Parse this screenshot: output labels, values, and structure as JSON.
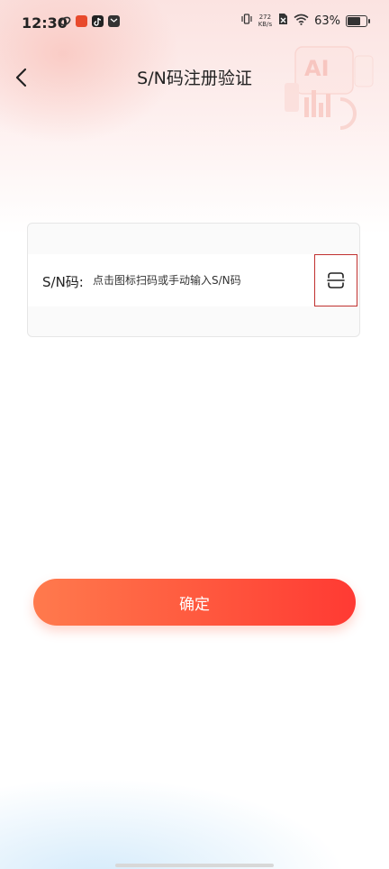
{
  "status_bar": {
    "time": "12:30",
    "net_speed_value": "272",
    "net_speed_unit": "KB/s",
    "battery_percent": "63%",
    "battery_level": 0.63
  },
  "header": {
    "title": "S/N码注册验证"
  },
  "decoration": {
    "text": "AI"
  },
  "form": {
    "sn_label": "S/N码:",
    "sn_placeholder": "点击图标扫码或手动输入S/N码",
    "sn_value": ""
  },
  "actions": {
    "confirm_label": "确定"
  },
  "colors": {
    "accent_start": "#ff7a4d",
    "accent_end": "#ff3a33",
    "highlight_border": "#c0302f"
  }
}
